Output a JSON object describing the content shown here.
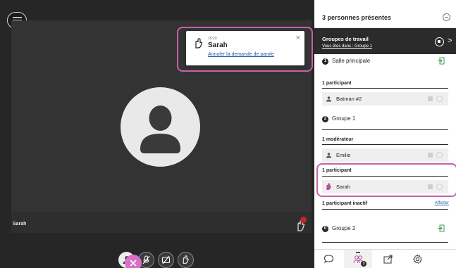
{
  "video": {
    "participant_name": "Sarah",
    "raise_hand_count": "1"
  },
  "notification": {
    "time": "15:23",
    "name": "Sarah",
    "action": "Annuler la demande de parole",
    "close_glyph": "×"
  },
  "controls": [
    {
      "icon": "avatar-icon",
      "status": "online"
    },
    {
      "icon": "microphone-off-icon"
    },
    {
      "icon": "camera-off-icon"
    },
    {
      "icon": "raise-hand-icon"
    }
  ],
  "panel": {
    "title": "3 personnes présentes",
    "groups": {
      "title": "Groupes de travail",
      "subtitle": "Vous êtes dans : Groupe 1",
      "arrow": ">"
    },
    "rooms": [
      {
        "number": "1",
        "name": "Salle principale"
      },
      {
        "number": "2",
        "name": "Groupe 1"
      },
      {
        "number": "0",
        "name": "Groupe 2"
      }
    ],
    "sections": {
      "main_participants": "1 participant",
      "group1_moderators": "1 modérateur",
      "group1_participants": "1 participant",
      "inactive": "1 participant inactif",
      "inactive_link": "Afficher"
    },
    "people": [
      {
        "name": "Batman #2",
        "icon": "user-icon"
      },
      {
        "name": "Emilie",
        "icon": "user-icon"
      },
      {
        "name": "Sarah",
        "icon": "raise-hand-icon"
      }
    ],
    "tabs": [
      {
        "icon": "chat-icon"
      },
      {
        "icon": "participants-icon",
        "badge": "3"
      },
      {
        "icon": "share-icon"
      },
      {
        "icon": "settings-icon"
      }
    ]
  },
  "colors": {
    "highlight": "#c660ac",
    "dark": "#262626",
    "link": "#1f5aa6",
    "alert": "#c8232c",
    "close_fab": "#d96fc8"
  }
}
